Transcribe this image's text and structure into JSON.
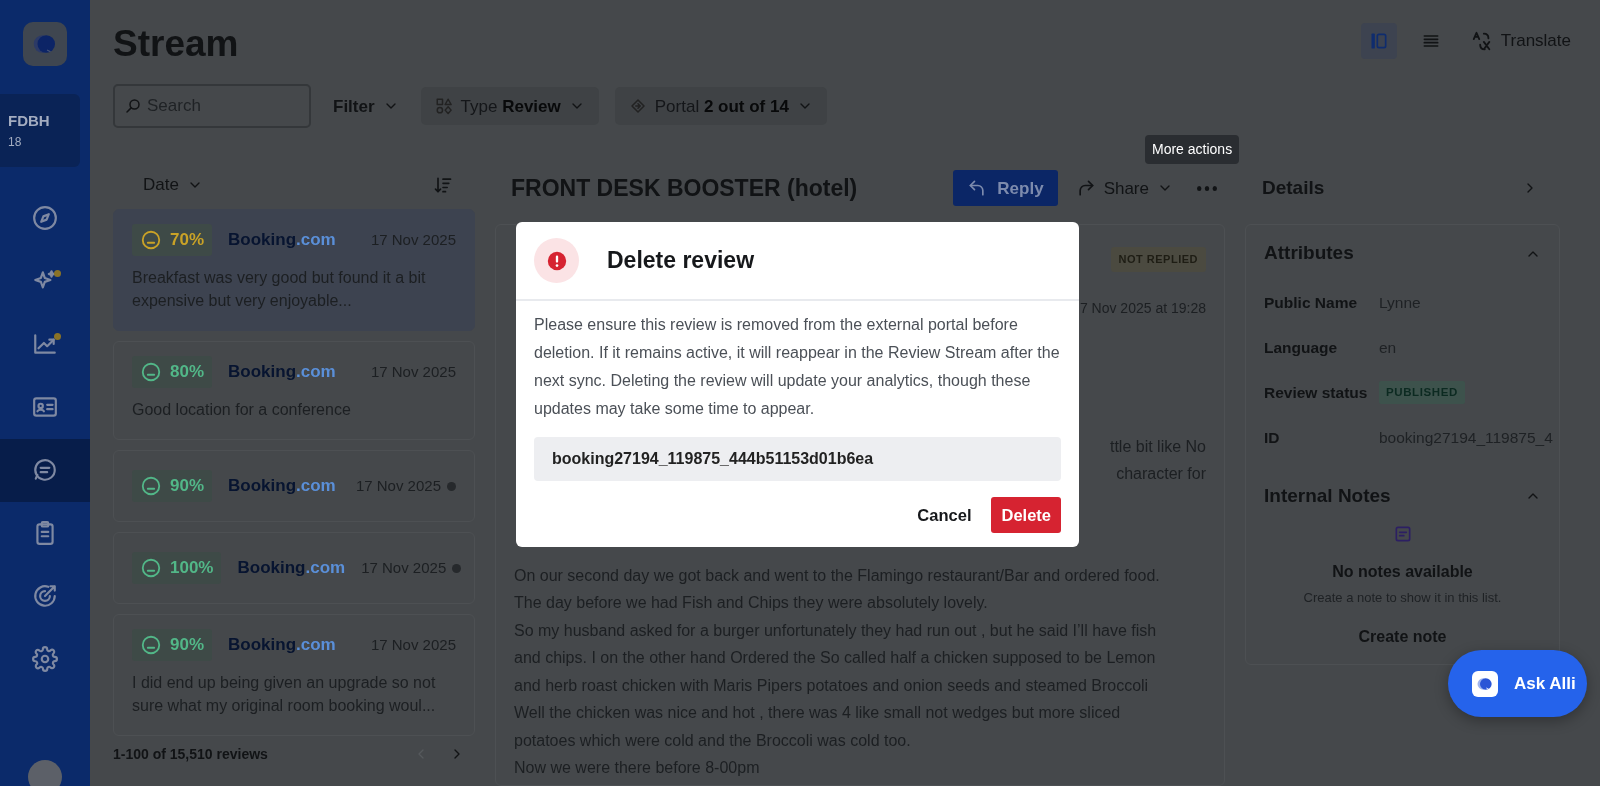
{
  "sidebar": {
    "account": {
      "code": "FDBH",
      "count": "18"
    },
    "nav": [
      {
        "kind": "compass",
        "selected": false,
        "notification": false
      },
      {
        "kind": "sparkles",
        "selected": false,
        "notification": true
      },
      {
        "kind": "chart",
        "selected": false,
        "notification": true
      },
      {
        "kind": "contact",
        "selected": false,
        "notification": false
      },
      {
        "kind": "chat",
        "selected": true,
        "notification": false
      },
      {
        "kind": "clipboard",
        "selected": false,
        "notification": false
      },
      {
        "kind": "target",
        "selected": false,
        "notification": false
      },
      {
        "kind": "gear",
        "selected": false,
        "notification": false
      }
    ]
  },
  "header": {
    "title": "Stream",
    "search": {
      "placeholder": "Search"
    },
    "filter": "Filter",
    "chips": [
      {
        "kind": "type",
        "label": "Type",
        "value": "Review"
      },
      {
        "kind": "portal",
        "label": "Portal",
        "value": "2 out of 14"
      }
    ],
    "views": [
      {
        "kind": "columns",
        "selected": true
      },
      {
        "kind": "list",
        "selected": false
      }
    ],
    "translate": "Translate"
  },
  "list": {
    "sort": "Date",
    "reviews": [
      {
        "score": "70%",
        "color": "#c9a227",
        "source_name": "Booking",
        "source_suffix": ".com",
        "date": "17 Nov 2025",
        "text": "Breakfast was very good but found it a bit expensive but very enjoyable...",
        "selected": true,
        "unread": false
      },
      {
        "score": "80%",
        "color": "#52b788",
        "source_name": "Booking",
        "source_suffix": ".com",
        "date": "17 Nov 2025",
        "text": "Good location for a conference",
        "selected": false,
        "unread": false
      },
      {
        "score": "90%",
        "color": "#52b788",
        "source_name": "Booking",
        "source_suffix": ".com",
        "date": "17 Nov 2025",
        "selected": false,
        "unread": true
      },
      {
        "score": "100%",
        "color": "#52b788",
        "source_name": "Booking",
        "source_suffix": ".com",
        "date": "17 Nov 2025",
        "selected": false,
        "unread": true
      },
      {
        "score": "90%",
        "color": "#52b788",
        "source_name": "Booking",
        "source_suffix": ".com",
        "date": "17 Nov 2025",
        "text": "I did end up being given an upgrade so not sure what my original room booking woul...",
        "selected": false,
        "unread": false
      }
    ],
    "footer": "1-100 of 15,510 reviews",
    "prev_disabled": true
  },
  "review": {
    "title": "FRONT DESK BOOSTER (hotel)",
    "reply": "Reply",
    "share": "Share",
    "tooltip": "More actions",
    "status": "NOT REPLIED",
    "date": "7 Nov 2025 at 19:28",
    "fragments": [
      "ttle bit like No",
      "character for"
    ],
    "lines": [
      "On our second day we got back and went to the Flamingo restaurant/Bar and ordered food.",
      "The day before we had Fish and Chips they were absolutely lovely.",
      "So my husband asked for a burger unfortunately they had run out , but he said I’ll have fish",
      "and chips. I on the other hand Ordered the So called half a chicken supposed to be Lemon",
      "and herb roast chicken with Maris Pipers potatoes and onion seeds and steamed Broccoli",
      "Well the chicken was nice and hot , there was 4 like small not wedges but more sliced",
      "potatoes which were cold and the Broccoli was cold too.",
      "Now we were there before 8-00pm"
    ]
  },
  "details": {
    "title": "Details",
    "attributes": {
      "title": "Attributes",
      "expanded": true,
      "rows": [
        {
          "label": "Public Name",
          "value": "Lynne",
          "kind": "text"
        },
        {
          "label": "Language",
          "value": "en",
          "kind": "text"
        },
        {
          "label": "Review status",
          "value": "PUBLISHED",
          "kind": "badge"
        },
        {
          "label": "ID",
          "value": "booking27194_119875_4",
          "kind": "text"
        }
      ]
    },
    "notes": {
      "title": "Internal Notes",
      "expanded": true,
      "empty_title": "No notes available",
      "empty_text": "Create a note to show it in this list.",
      "create": "Create note"
    }
  },
  "modal": {
    "title": "Delete review",
    "body": "Please ensure this review is removed from the external portal before deletion. If it remains active, it will reappear in the Review Stream after the next sync. Deleting the review will update your analytics, though these updates may take some time to appear.",
    "id_value": "booking27194_119875_444b51153d01b6ea",
    "cancel": "Cancel",
    "delete": "Delete"
  },
  "assistant": {
    "label": "Ask Alli"
  }
}
